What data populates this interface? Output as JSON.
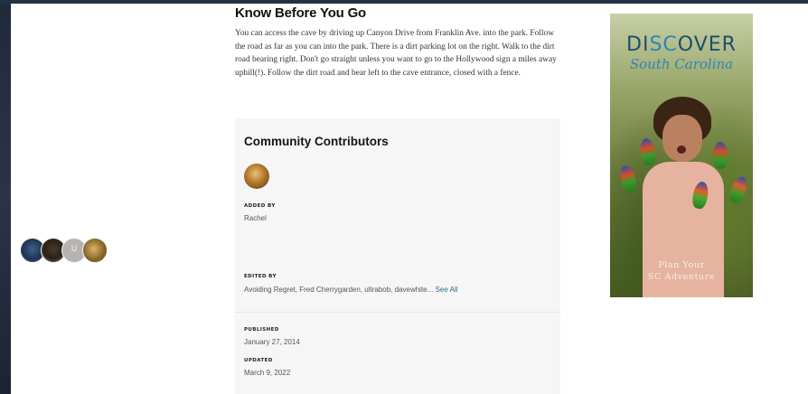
{
  "section": {
    "title": "Know Before You Go",
    "body": "You can access the cave by driving up Canyon Drive from Franklin Ave. into the park. Follow the road as far as you can into the park. There is a dirt parking lot on the right. Walk to the dirt road bearing right. Don't go straight unless you want to go to the Hollywood sign a miles away uphill(!). Follow the dirt road and bear left to the cave entrance, closed with a fence."
  },
  "contributors": {
    "title": "Community Contributors",
    "added_by_label": "ADDED BY",
    "added_by": "Rachel",
    "edited_by_label": "EDITED BY",
    "edited_by": "Avoiding Regret, Fred Cherrygarden, ultrabob, davewhite...",
    "see_all": "See All",
    "editor_initial": "U",
    "published_label": "PUBLISHED",
    "published": "January 27, 2014",
    "updated_label": "UPDATED",
    "updated": "March 9, 2022"
  },
  "ad": {
    "brand_prefix": "DI",
    "brand_highlight": "SC",
    "brand_suffix": "OVER",
    "subtitle": "South Carolina",
    "cta_line1": "Plan Your",
    "cta_line2": "SC Adventure"
  }
}
